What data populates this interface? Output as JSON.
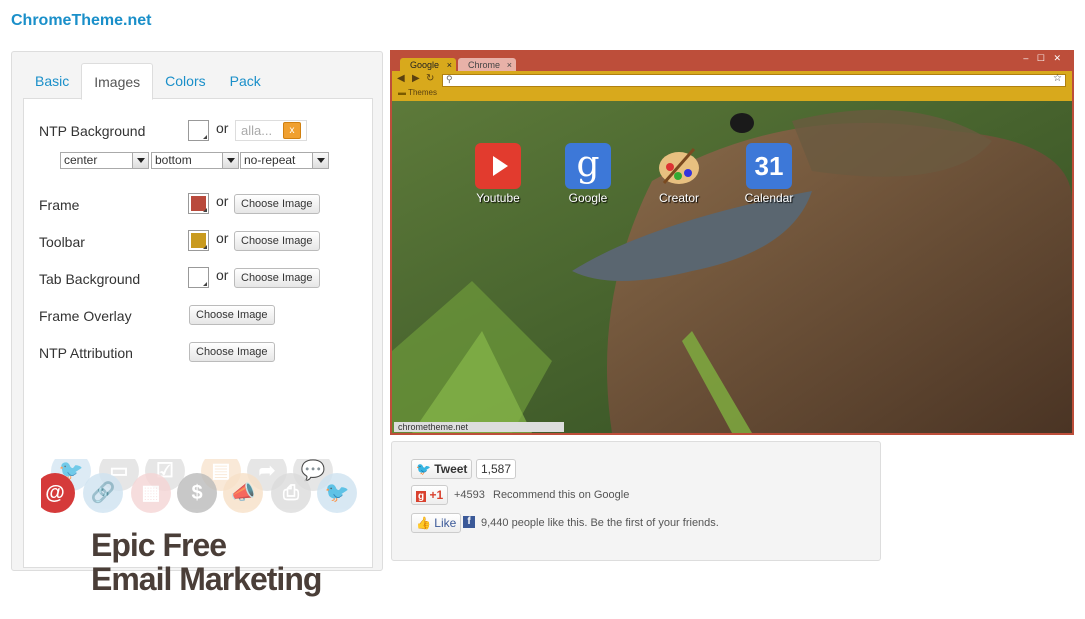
{
  "site": {
    "logo": "ChromeTheme.net"
  },
  "tabs": [
    {
      "label": "Basic"
    },
    {
      "label": "Images"
    },
    {
      "label": "Colors"
    },
    {
      "label": "Pack"
    }
  ],
  "form": {
    "ntp_background": {
      "label": "NTP Background",
      "or": "or",
      "url_placeholder": "alla...",
      "clear_label": "x"
    },
    "position": {
      "h": "center",
      "v": "bottom",
      "repeat": "no-repeat"
    },
    "frame": {
      "label": "Frame",
      "or": "or",
      "button": "Choose Image",
      "color": "#b94a3c"
    },
    "toolbar": {
      "label": "Toolbar",
      "or": "or",
      "button": "Choose Image",
      "color": "#c99a1e"
    },
    "tab_background": {
      "label": "Tab Background",
      "or": "or",
      "button": "Choose Image",
      "color": "#ffffff"
    },
    "frame_overlay": {
      "label": "Frame Overlay",
      "button": "Choose Image"
    },
    "ntp_attribution": {
      "label": "NTP Attribution",
      "button": "Choose Image"
    }
  },
  "ad": {
    "line1": "Epic Free",
    "line2": "Email Marketing"
  },
  "preview": {
    "tabs": [
      {
        "label": "Google",
        "close": "×"
      },
      {
        "label": "Chrome",
        "close": "×"
      }
    ],
    "window_controls": "– ☐ ✕",
    "bookmark": "Themes",
    "star": "☆",
    "apps": [
      {
        "label": "Youtube",
        "icon": "youtube-icon"
      },
      {
        "label": "Google",
        "icon": "google-icon",
        "glyph": "g"
      },
      {
        "label": "Creator",
        "icon": "palette-icon"
      },
      {
        "label": "Calendar",
        "icon": "calendar-icon",
        "glyph": "31"
      }
    ],
    "attribution": "chrometheme.net"
  },
  "social": {
    "tweet": "Tweet",
    "tweet_count": "1,587",
    "plusone": "+1",
    "plusone_count": "+4593",
    "plusone_text": "Recommend this on Google",
    "like": "Like",
    "like_text": "9,440 people like this. Be the first of your friends."
  }
}
